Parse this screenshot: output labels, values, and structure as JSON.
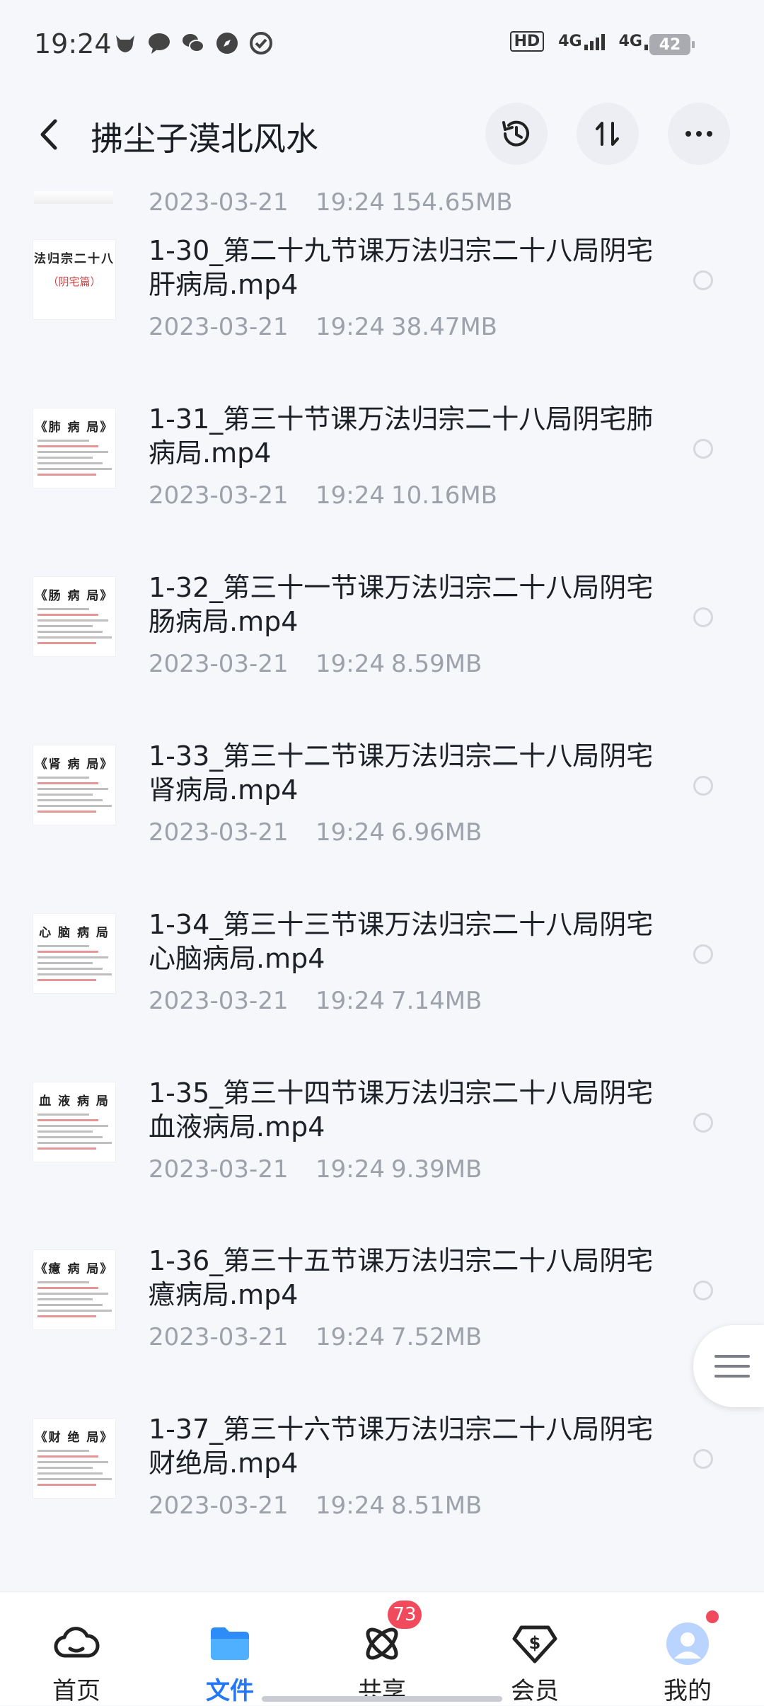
{
  "status_bar": {
    "time": "19:24",
    "hd": "HD",
    "net1": "4G",
    "net2": "4G",
    "battery": "42"
  },
  "header": {
    "back_icon": "chevron-left-icon",
    "title": "拂尘子漠北风水",
    "actions": [
      "history-icon",
      "sort-icon",
      "more-icon"
    ]
  },
  "partial_item": {
    "date": "2023-03-21",
    "time": "19:24",
    "size": "154.65MB"
  },
  "files": [
    {
      "name": "1-30_第二十九节课万法归宗二十八局阴宅肝病局.mp4",
      "date": "2023-03-21",
      "time": "19:24",
      "size": "38.47MB",
      "thumb_title": "法归宗二十八",
      "thumb_sub": "（阴宅篇）"
    },
    {
      "name": "1-31_第三十节课万法归宗二十八局阴宅肺病局.mp4",
      "date": "2023-03-21",
      "time": "19:24",
      "size": "10.16MB",
      "thumb_title": "《肺 病 局》",
      "thumb_sub": ""
    },
    {
      "name": "1-32_第三十一节课万法归宗二十八局阴宅肠病局.mp4",
      "date": "2023-03-21",
      "time": "19:24",
      "size": "8.59MB",
      "thumb_title": "《肠 病 局》",
      "thumb_sub": ""
    },
    {
      "name": "1-33_第三十二节课万法归宗二十八局阴宅肾病局.mp4",
      "date": "2023-03-21",
      "time": "19:24",
      "size": "6.96MB",
      "thumb_title": "《肾 病 局》",
      "thumb_sub": ""
    },
    {
      "name": "1-34_第三十三节课万法归宗二十八局阴宅心脑病局.mp4",
      "date": "2023-03-21",
      "time": "19:24",
      "size": "7.14MB",
      "thumb_title": "心 脑 病 局",
      "thumb_sub": ""
    },
    {
      "name": "1-35_第三十四节课万法归宗二十八局阴宅血液病局.mp4",
      "date": "2023-03-21",
      "time": "19:24",
      "size": "9.39MB",
      "thumb_title": "血 液 病 局",
      "thumb_sub": ""
    },
    {
      "name": "1-36_第三十五节课万法归宗二十八局阴宅癔病局.mp4",
      "date": "2023-03-21",
      "time": "19:24",
      "size": "7.52MB",
      "thumb_title": "《癔 病 局》",
      "thumb_sub": ""
    },
    {
      "name": "1-37_第三十六节课万法归宗二十八局阴宅财绝局.mp4",
      "date": "2023-03-21",
      "time": "19:24",
      "size": "8.51MB",
      "thumb_title": "《财 绝 局》",
      "thumb_sub": ""
    }
  ],
  "bottom_nav": [
    {
      "label": "首页",
      "icon": "cloud-home-icon"
    },
    {
      "label": "文件",
      "icon": "folder-icon",
      "active": true
    },
    {
      "label": "共享",
      "icon": "share-atom-icon",
      "badge": "73"
    },
    {
      "label": "会员",
      "icon": "vip-diamond-icon"
    },
    {
      "label": "我的",
      "icon": "avatar-icon"
    }
  ],
  "colors": {
    "accent": "#2478f5",
    "badge": "#f04a5c",
    "meta_text": "#9da1aa"
  }
}
